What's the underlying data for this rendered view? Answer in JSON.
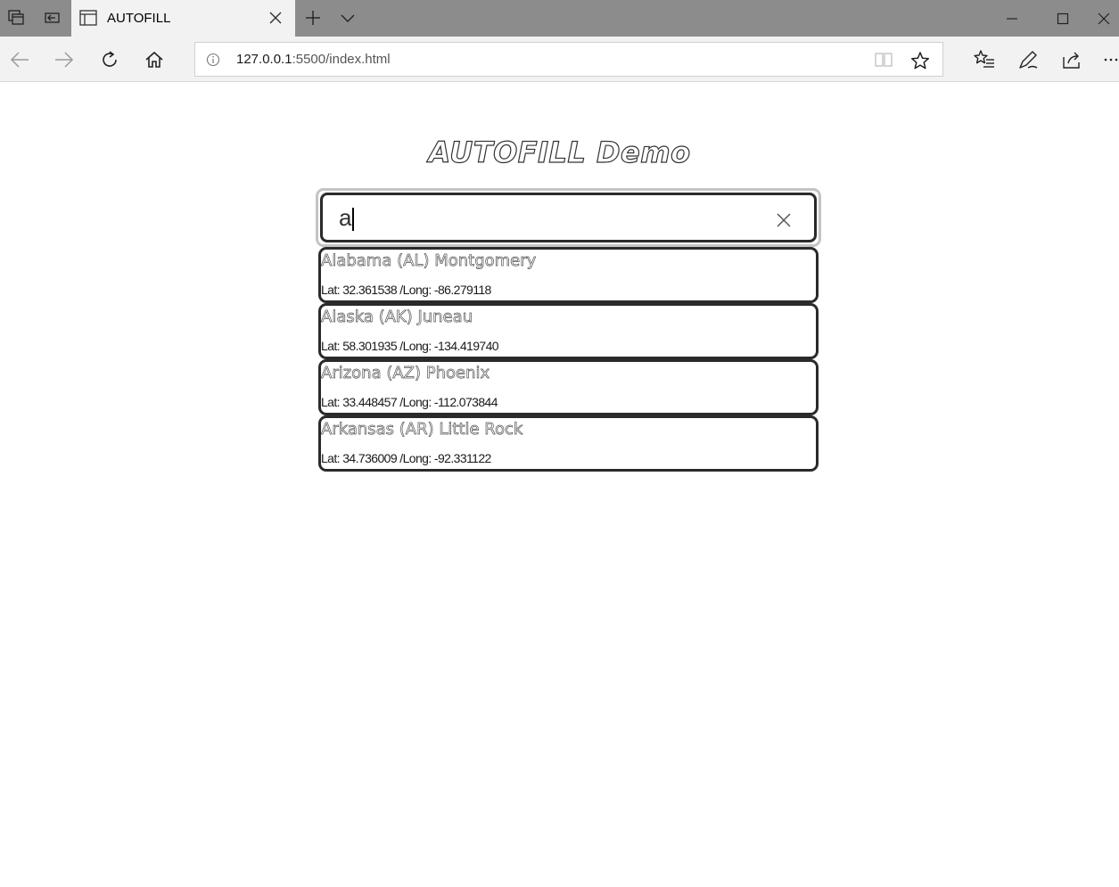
{
  "browser": {
    "tab": {
      "title": "AUTOFILL"
    },
    "address": {
      "host": "127.0.0.1",
      "path": ":5500/index.html"
    },
    "icons": {
      "tab_manager": "tab-manager-icon",
      "set_aside": "set-aside-tabs-icon",
      "new_tab": "plus-icon",
      "tab_menu": "chevron-down-icon",
      "back": "back-arrow-icon",
      "forward": "forward-arrow-icon",
      "refresh": "refresh-icon",
      "home": "home-icon",
      "info": "info-icon",
      "reading_view": "reading-view-icon",
      "favorite": "star-icon",
      "favorites_hub": "favorites-list-icon",
      "web_note": "pen-icon",
      "share": "share-icon",
      "more": "more-icon"
    }
  },
  "page": {
    "title": "AUTOFILL Demo",
    "search": {
      "value": "a"
    },
    "results": [
      {
        "name": "Alabama (AL) Montgomery",
        "coords": "Lat: 32.361538 /Long: -86.279118"
      },
      {
        "name": "Alaska (AK) Juneau",
        "coords": "Lat: 58.301935 /Long: -134.419740"
      },
      {
        "name": "Arizona (AZ) Phoenix",
        "coords": "Lat: 33.448457 /Long: -112.073844"
      },
      {
        "name": "Arkansas (AR) Little Rock",
        "coords": "Lat: 34.736009 /Long: -92.331122"
      }
    ]
  }
}
